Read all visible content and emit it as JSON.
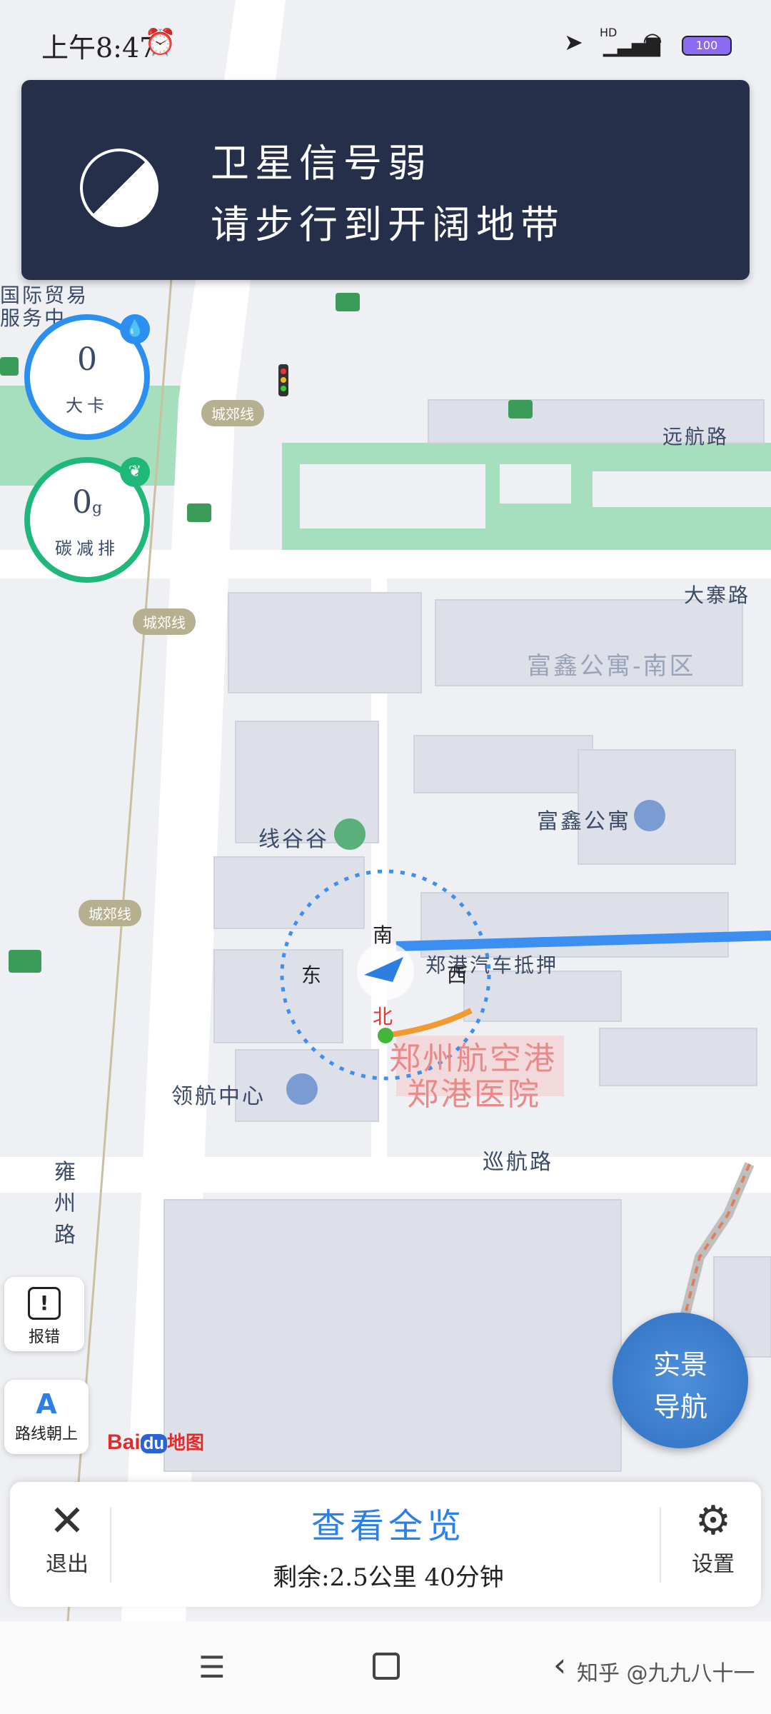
{
  "status_bar": {
    "time": "上午8:47",
    "network": "HD",
    "battery": "100"
  },
  "banner": {
    "line1": "卫星信号弱",
    "line2": "请步行到开阔地带"
  },
  "stats": {
    "calories": {
      "value": "0",
      "label": "大卡"
    },
    "carbon": {
      "value": "0",
      "unit": "g",
      "label": "碳减排"
    }
  },
  "map": {
    "labels": {
      "trade": "国际贸易",
      "trade2": "服务中",
      "yuanhang_road": "远航路",
      "dazhai_road": "大寨路",
      "fuxin_south": "富鑫公寓-南区",
      "fuxin": "富鑫公寓",
      "xiangu": "线谷谷",
      "lingfeng_center": "领航中心",
      "xunhang_road": "巡航路",
      "yongzhou_road": "雍州路",
      "hospital_1": "郑州航空港",
      "hospital_2": "郑港医院",
      "route_label": "郑港汽车抵押"
    },
    "road_tags": [
      "城郊线",
      "城郊线",
      "城郊线"
    ],
    "compass": {
      "n": "南",
      "s": "北",
      "e": "西",
      "w": "东"
    },
    "logo": {
      "bai": "Bai",
      "du": "du",
      "map": "地图"
    },
    "colors": {
      "route": "#3c8ef0",
      "green": "#9bdcb4",
      "banner": "#262f4a"
    }
  },
  "side_buttons": {
    "report": "报错",
    "route_up": "路线朝上",
    "ar_nav_1": "实景",
    "ar_nav_2": "导航"
  },
  "nav_card": {
    "exit_label": "退出",
    "overview": "查看全览",
    "remaining": "剩余:2.5公里 40分钟",
    "settings_label": "设置"
  },
  "watermark": "知乎 @九九八十一"
}
